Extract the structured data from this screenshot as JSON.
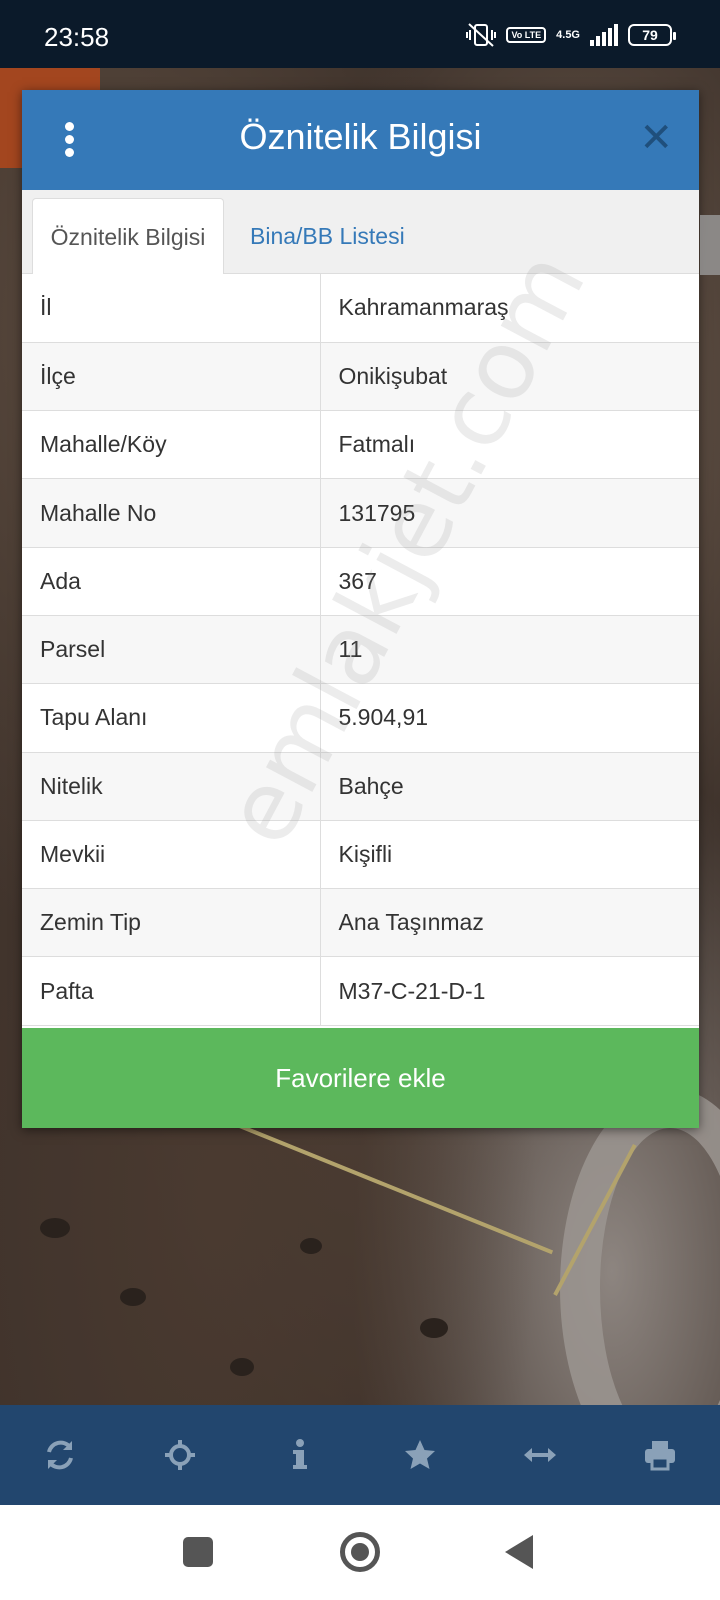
{
  "status_bar": {
    "time": "23:58",
    "volte": "Vo LTE",
    "network": "4.5G",
    "battery": "79"
  },
  "modal": {
    "title": "Öznitelik Bilgisi",
    "menu_icon": "kebab-menu-icon",
    "close_icon": "close-icon",
    "tabs": [
      {
        "label": "Öznitelik Bilgisi",
        "active": true
      },
      {
        "label": "Bina/BB Listesi",
        "active": false
      }
    ],
    "rows": [
      {
        "key": "İl",
        "value": "Kahramanmaraş"
      },
      {
        "key": "İlçe",
        "value": "Onikişubat"
      },
      {
        "key": "Mahalle/Köy",
        "value": "Fatmalı"
      },
      {
        "key": "Mahalle No",
        "value": "131795"
      },
      {
        "key": "Ada",
        "value": "367"
      },
      {
        "key": "Parsel",
        "value": "11"
      },
      {
        "key": "Tapu Alanı",
        "value": "5.904,91"
      },
      {
        "key": "Nitelik",
        "value": "Bahçe"
      },
      {
        "key": "Mevkii",
        "value": "Kişifli"
      },
      {
        "key": "Zemin Tip",
        "value": "Ana Taşınmaz"
      },
      {
        "key": "Pafta",
        "value": "M37-C-21-D-1"
      }
    ],
    "favorite_button": "Favorilere ekle"
  },
  "watermark": "emlakjet.com",
  "toolbar": {
    "icons": [
      "refresh-icon",
      "locate-icon",
      "info-icon",
      "star-icon",
      "measure-icon",
      "print-icon"
    ]
  },
  "colors": {
    "header": "#3579b8",
    "button_green": "#5cb85c",
    "toolbar": "#22466e",
    "statusbar": "#0b1a2a"
  }
}
